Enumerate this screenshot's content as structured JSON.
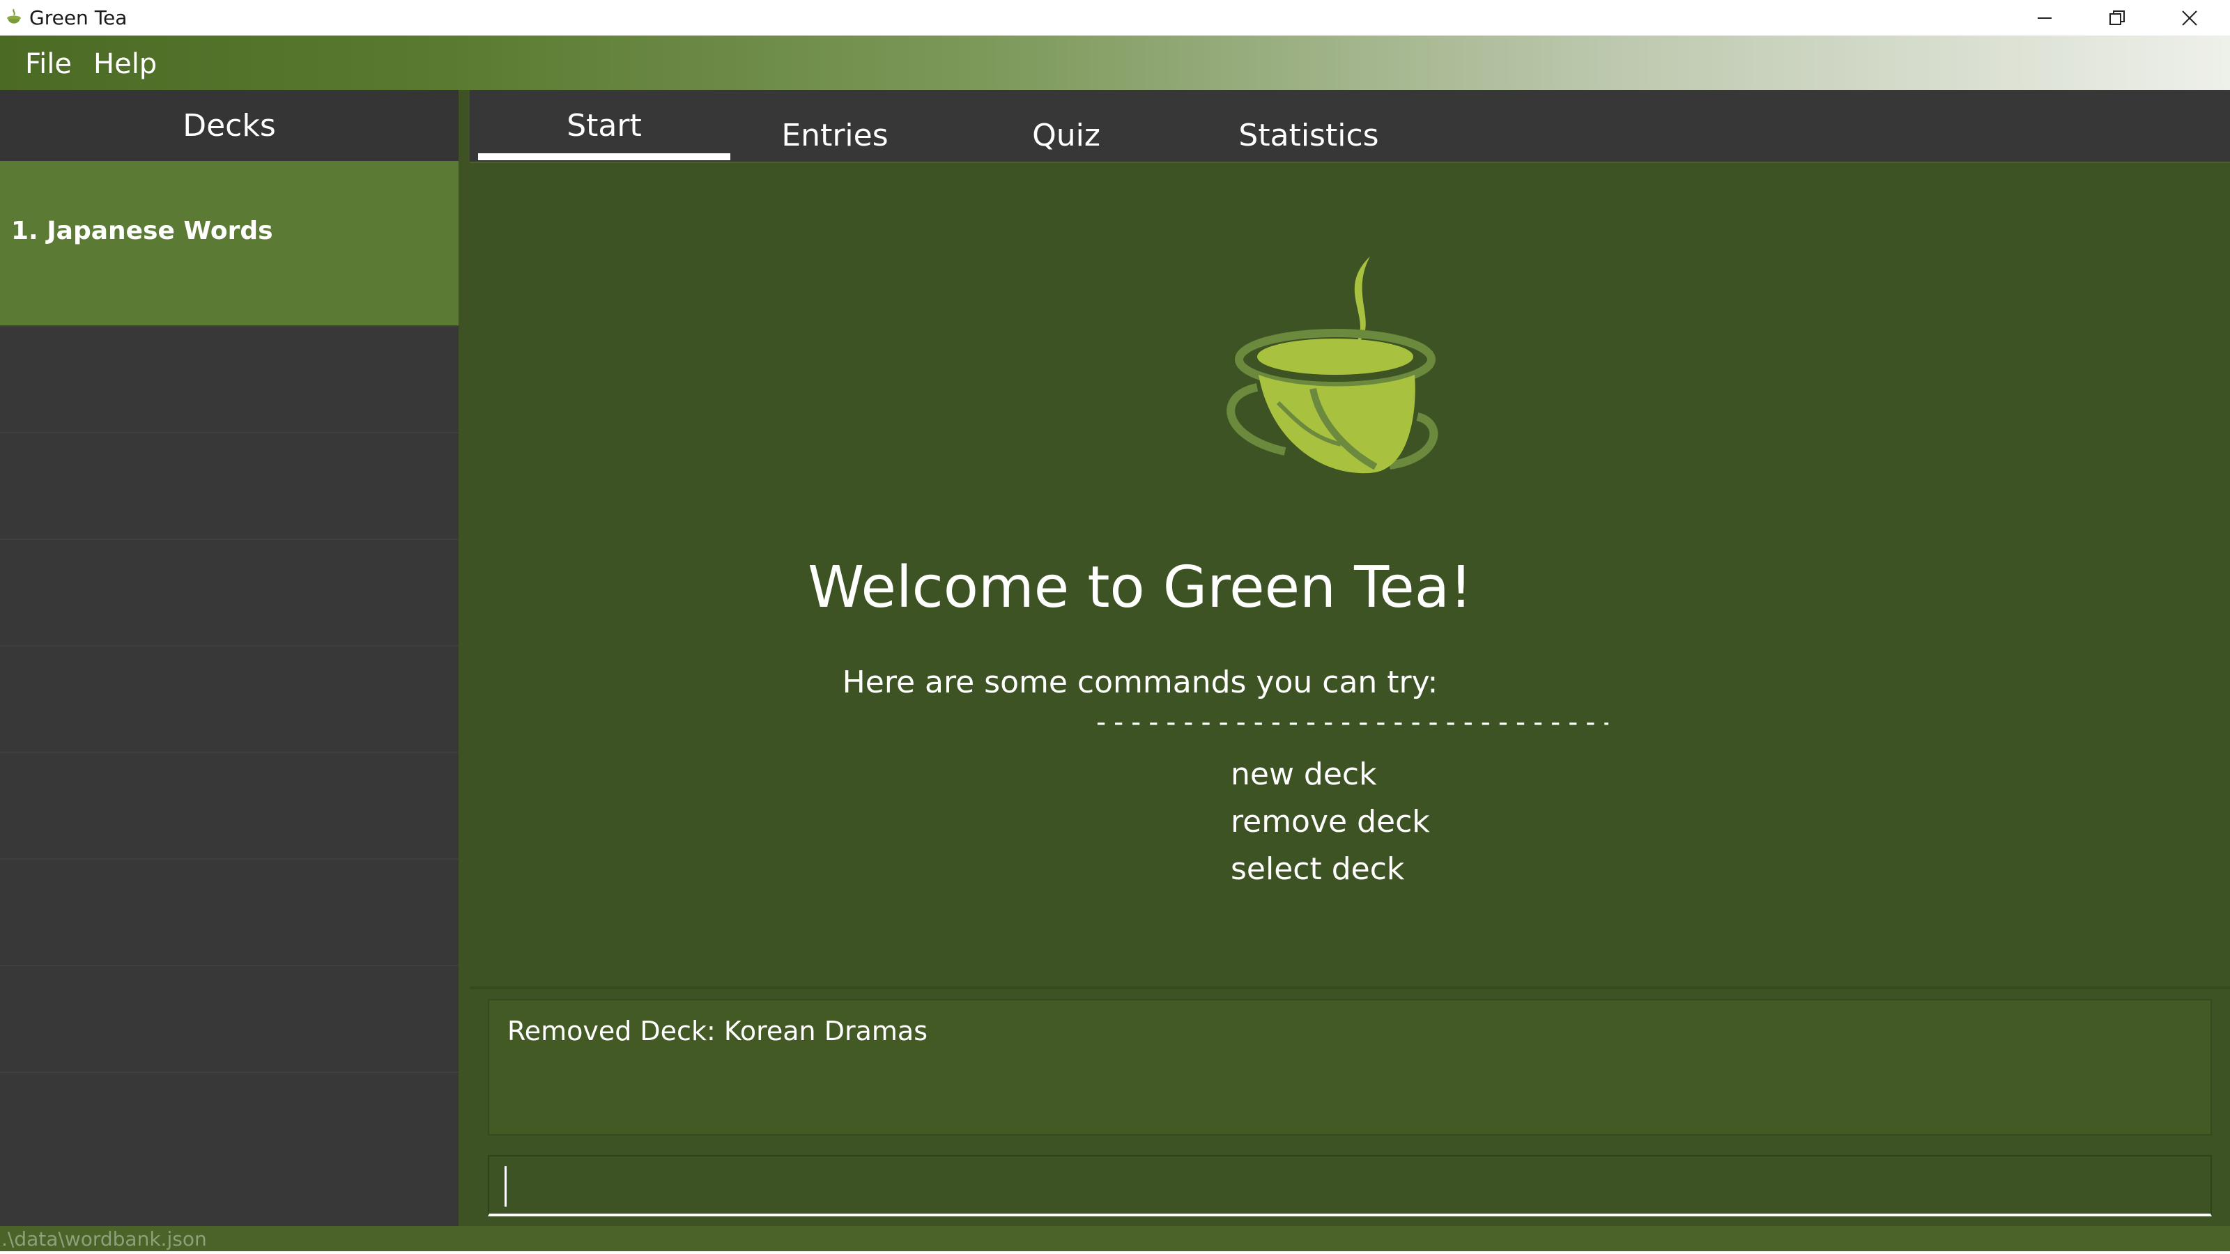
{
  "window": {
    "title": "Green Tea",
    "icon": "green-tea-app-icon",
    "controls": [
      "minimize-icon",
      "restore-icon",
      "close-icon"
    ]
  },
  "menu": {
    "items": [
      {
        "label": "File"
      },
      {
        "label": "Help"
      }
    ]
  },
  "sidebar": {
    "title": "Decks",
    "decks": [
      {
        "label": "1.  Japanese Words",
        "selected": true
      }
    ]
  },
  "tabs": [
    {
      "label": "Start",
      "active": true
    },
    {
      "label": "Entries",
      "active": false
    },
    {
      "label": "Quiz",
      "active": false
    },
    {
      "label": "Statistics",
      "active": false
    }
  ],
  "start": {
    "logo": "green-tea-cup-logo",
    "welcome": "Welcome to Green Tea!",
    "commands_intro": "Here are some commands you can try:",
    "divider": "------------------------------------------",
    "commands": [
      "new deck",
      "remove deck",
      "select deck"
    ]
  },
  "result": {
    "text": "Removed Deck: Korean Dramas"
  },
  "command_box": {
    "value": ""
  },
  "status": {
    "path": ".\\data\\wordbank.json"
  },
  "colors": {
    "background": "#3e5224",
    "selected_deck": "#5b7a34",
    "tab_bar": "#373737",
    "sidebar": "#383838",
    "logo_light": "#a8c240",
    "logo_dark": "#6c8a3e"
  }
}
